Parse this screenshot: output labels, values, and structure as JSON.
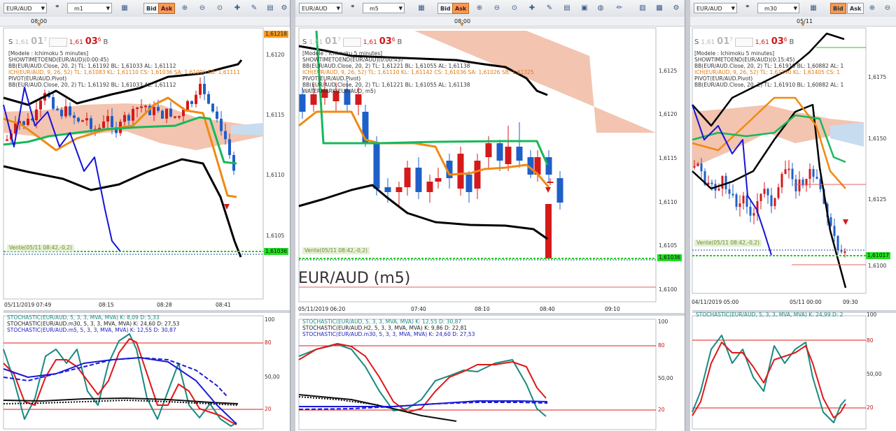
{
  "panels": [
    {
      "id": "p1",
      "symbol": "EUR/AUD",
      "timeframe": "m1",
      "bid_label": "Bid",
      "ask_label": "Ask",
      "top_time": "08:00",
      "quote": {
        "s": "S",
        "sell_small": "1,61",
        "sell_big": "01",
        "sell_sup": "7",
        "buy_small": "1,61",
        "buy_big": "03",
        "buy_sup": "6",
        "b": "B"
      },
      "info": [
        {
          "text": "[Modele : Ichimoku 5 minutes]",
          "color": "#333333"
        },
        {
          "text": "SHOWTIMETOEND(EUR/AUD)(0:00:45)",
          "color": "#333333"
        },
        {
          "text": "BB(EUR/AUD.Close, 20, 2)  TL: 1,61192  BL: 1,61033  AL: 1,61112",
          "color": "#333333"
        },
        {
          "text": "ICH(EUR/AUD, 9, 26, 52)  TL: 1,61083  KL: 1,61110  CS: 1,61036  SA: 1,61096  SB: 1,61111",
          "color": "#e07a10"
        },
        {
          "text": "PIVOT(EUR/AUD.Pivot)",
          "color": "#333333"
        },
        {
          "text": "BB(EUR/AUD.Close, 20, 2)  TL: 1,61192  BL: 1,61033  AL: 1,61112",
          "color": "#333333"
        }
      ],
      "price_labels": [
        "1,6120",
        "1,6115",
        "1,6110",
        "1,6105"
      ],
      "price_top_tag": "1,61218",
      "price_cur_tag": "1,61036",
      "vente": "Vente(05/11 08:42,-0,2)",
      "x_labels": [
        "05/11/2019 07:49",
        "08:15",
        "08:28",
        "08:41"
      ],
      "stoch_lines": [
        {
          "text": "STOCHASTIC(EUR/AUD, 5, 3, 3, MVA, MVA)  K: 8,09  D: 5,33",
          "color": "#1a8a80"
        },
        {
          "text": "STOCHASTIC(EUR/AUD.m30, 5, 3, 3, MVA, MVA)  K: 24,60  D: 27,53",
          "color": "#222222"
        },
        {
          "text": "STOCHASTIC(EUR/AUD.m5, 5, 3, 3, MVA, MVA)  K: 12,55  D: 30,87",
          "color": "#2020c0"
        }
      ],
      "stoch_axis": [
        "100",
        "80",
        "50,00",
        "20"
      ]
    },
    {
      "id": "p2",
      "symbol": "EUR/AUD",
      "timeframe": "m5",
      "bid_label": "Bid",
      "ask_label": "Ask",
      "top_time": "08:00",
      "quote": {
        "s": "S",
        "sell_small": "1,61",
        "sell_big": "01",
        "sell_sup": "7",
        "buy_small": "1,61",
        "buy_big": "03",
        "buy_sup": "6",
        "b": "B"
      },
      "info": [
        {
          "text": "[Modele : Ichimoku 5 minutes]",
          "color": "#333333"
        },
        {
          "text": "SHOWTIMETOEND(EUR/AUD)(0:00:45)",
          "color": "#333333"
        },
        {
          "text": "BB(EUR/AUD.Close, 20, 2)  TL: 1,61221  BL: 1,61055  AL: 1,61138",
          "color": "#333333"
        },
        {
          "text": "ICH(EUR/AUD, 9, 26, 52)  TL: 1,61110  KL: 1,61142  CS: 1,61036  SA: 1,61026  SB: 1,61325",
          "color": "#e07a10"
        },
        {
          "text": "PIVOT(EUR/AUD.Pivot)",
          "color": "#333333"
        },
        {
          "text": "BB(EUR/AUD.Close, 20, 2)  TL: 1,61221  BL: 1,61055  AL: 1,61138",
          "color": "#333333"
        },
        {
          "text": "WATERMARK(EUR/AUD, m5)",
          "color": "#333333"
        }
      ],
      "price_labels": [
        "1,6125",
        "1,6120",
        "1,6115",
        "1,6110",
        "1,6105",
        "1,6100"
      ],
      "price_cur_tag": "1,61036",
      "vente": "Vente(05/11 08:42,-0,2)",
      "watermark": "EUR/AUD (m5)",
      "x_labels": [
        "05/11/2019 06:20",
        "07:40",
        "08:10",
        "08:40",
        "09:10"
      ],
      "stoch_lines": [
        {
          "text": "STOCHASTIC(EUR/AUD, 5, 3, 3, MVA, MVA)  K: 12,55  D: 30,87",
          "color": "#1a8a80"
        },
        {
          "text": "STOCHASTIC(EUR/AUD.H2, 5, 3, 3, MVA, MVA)  K: 9,86  D: 22,81",
          "color": "#222222"
        },
        {
          "text": "STOCHASTIC(EUR/AUD.m30, 5, 3, 3, MVA, MVA)  K: 24,60  D: 27,53",
          "color": "#2020c0"
        }
      ],
      "stoch_axis": [
        "100",
        "80",
        "50,00",
        "20"
      ]
    },
    {
      "id": "p3",
      "symbol": "EUR/AUD",
      "timeframe": "m30",
      "bid_label": "Bid",
      "ask_label": "Ask",
      "top_time": "05/11",
      "quote": {
        "s": "S",
        "sell_small": "1,61",
        "sell_big": "01",
        "sell_sup": "7",
        "buy_small": "1,61",
        "buy_big": "03",
        "buy_sup": "6",
        "b": "B"
      },
      "info": [
        {
          "text": "[Modele : Ichimoku 5 minutes]",
          "color": "#333333"
        },
        {
          "text": "SHOWTIMETOEND(EUR/AUD)(0:15:45)",
          "color": "#333333"
        },
        {
          "text": "BB(EUR/AUD.Close, 20, 2)  TL: 1,61910  BL: 1,60882  AL: 1",
          "color": "#333333"
        },
        {
          "text": "ICH(EUR/AUD, 9, 26, 52)  TL: 1,61290  KL: 1,61405  CS: 1",
          "color": "#e07a10"
        },
        {
          "text": "PIVOT(EUR/AUD.Pivot)",
          "color": "#333333"
        },
        {
          "text": "BB(EUR/AUD.Close, 20, 2)  TL: 1,61910  BL: 1,60882  AL: 1",
          "color": "#333333"
        }
      ],
      "price_labels": [
        "1,6175",
        "1,6150",
        "1,6125",
        "1,6100"
      ],
      "price_cur_tag": "1,61017",
      "vente": "Vente(05/11 08:42,-0,2)",
      "x_labels": [
        "04/11/2019 05:00",
        "05/11 00:00",
        "09:30"
      ],
      "stoch_lines": [
        {
          "text": "STOCHASTIC(EUR/AUD, 5, 3, 3, MVA, MVA)  K: 24,99  D: 2",
          "color": "#1a8a80"
        }
      ],
      "stoch_axis": [
        "100",
        "80",
        "50,00",
        "20"
      ]
    }
  ],
  "colors": {
    "bull": "#1f5fc8",
    "bear": "#d41a1a",
    "ichimoku_tenkan": "#f08a10",
    "ichimoku_kijun": "#18b85a",
    "bollinger": "#000000",
    "chikou": "#1515d8",
    "cloud": "#f3c4b0",
    "cloud_blue": "#c8dcf0",
    "current_price": "#22cc22",
    "stoch_k": "#1a8a80",
    "stoch_d": "#e01818"
  }
}
